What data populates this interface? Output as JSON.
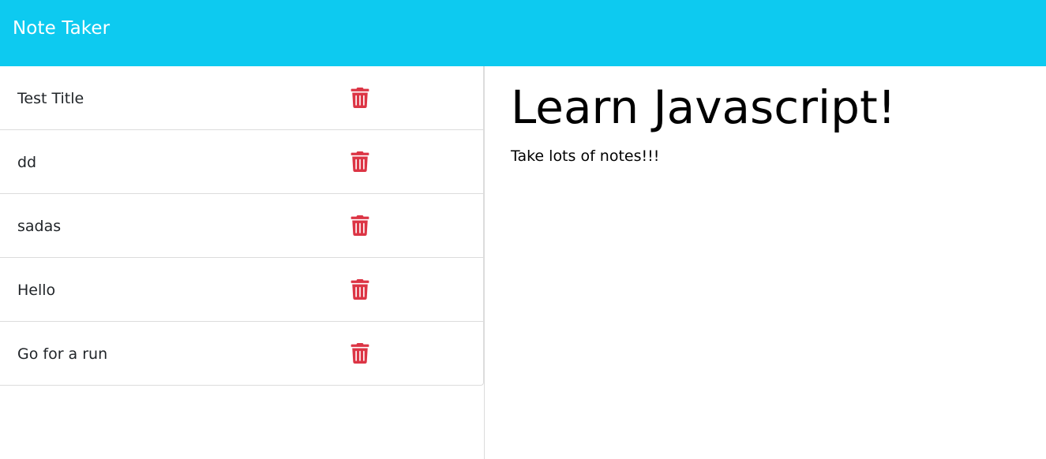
{
  "navbar": {
    "brand": "Note Taker",
    "background_color": "#0dcaf0"
  },
  "sidebar": {
    "notes": [
      {
        "title": "Test Title",
        "delete_icon": "trash-icon"
      },
      {
        "title": "dd",
        "delete_icon": "trash-icon"
      },
      {
        "title": "sadas",
        "delete_icon": "trash-icon"
      },
      {
        "title": "Hello",
        "delete_icon": "trash-icon"
      },
      {
        "title": "Go for a run",
        "delete_icon": "trash-icon"
      }
    ],
    "delete_icon_color": "#dc3545"
  },
  "main": {
    "note_title": "Learn Javascript!",
    "note_text": "Take lots of notes!!!"
  }
}
